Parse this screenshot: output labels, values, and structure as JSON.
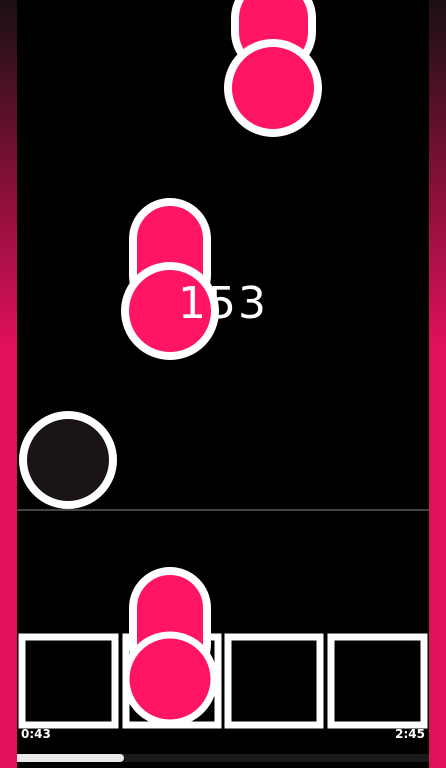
{
  "game": {
    "combo": "153",
    "time_elapsed": "0:43",
    "time_total": "2:45",
    "progress": 0.26,
    "lane_count": 4
  },
  "colors": {
    "background": "#000000",
    "note": "#ff1466",
    "note_outline": "#ffffff",
    "side_bar_gradient_top": "#1a1013",
    "side_bar_gradient_bottom": "#e0105a",
    "idle_orb_fill": "#1a1415",
    "hit_line": "#444444",
    "progress_fill": "#e8e8e8",
    "progress_track": "#1a1a1a"
  },
  "icons": {
    "notes": "pink-capsule-note",
    "idle_orb": "dark-circle-orb",
    "lane_targets": "square-lane-target"
  }
}
